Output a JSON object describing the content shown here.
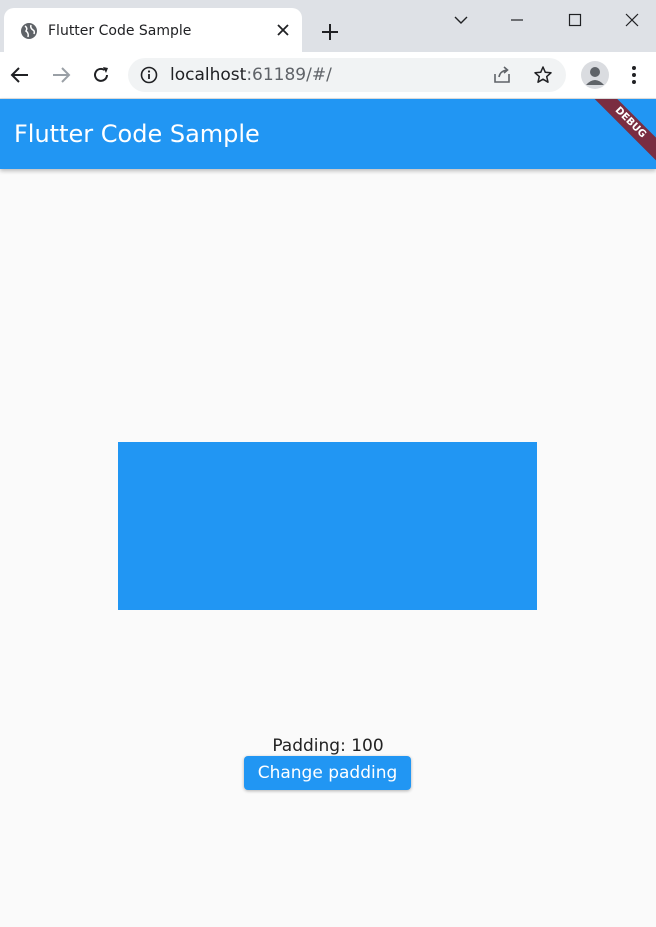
{
  "browser": {
    "tab_title": "Flutter Code Sample",
    "url_host": "localhost",
    "url_rest": ":61189/#/"
  },
  "app": {
    "title": "Flutter Code Sample",
    "debug_banner": "DEBUG",
    "padding_label": "Padding: 100",
    "button_label": "Change padding",
    "primary_color": "#2196f3"
  }
}
